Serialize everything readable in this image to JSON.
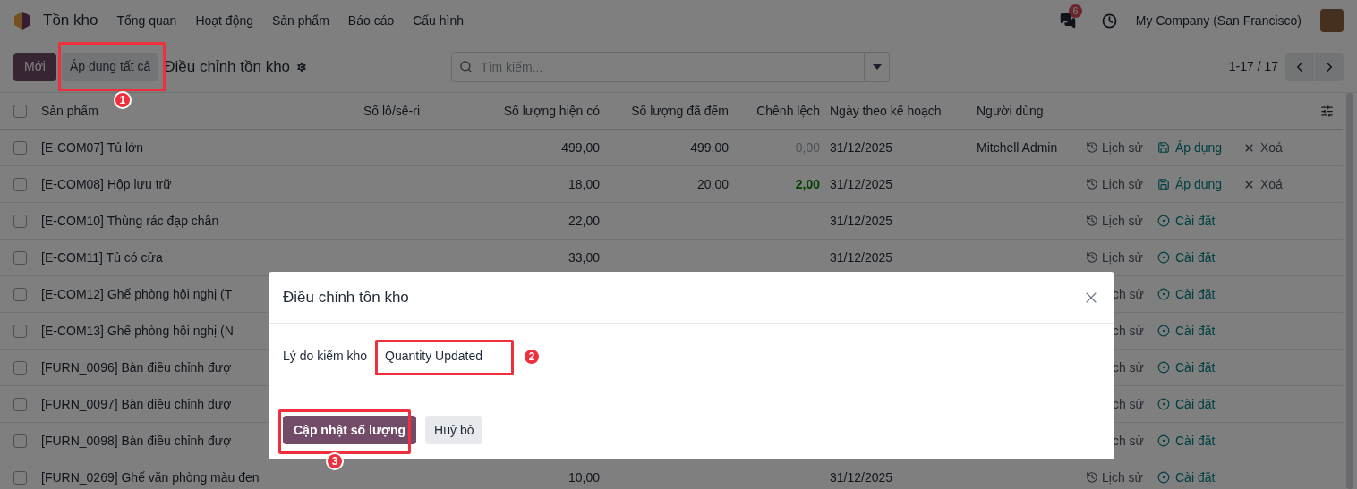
{
  "navbar": {
    "app_name": "Tồn kho",
    "menu": [
      "Tổng quan",
      "Hoạt động",
      "Sản phẩm",
      "Báo cáo",
      "Cấu hình"
    ],
    "message_count": "6",
    "company": "My Company (San Francisco)"
  },
  "control_panel": {
    "new_button": "Mới",
    "apply_all_button": {
      "label": "Áp dụng tất cả",
      "annotation": "1"
    },
    "title": "Điều chỉnh tồn kho",
    "search": {
      "placeholder": "Tìm kiếm..."
    },
    "pager": "1-17 / 17"
  },
  "table": {
    "select_all": {
      "checked": false
    },
    "columns": [
      "Sản phẩm",
      "Số lô/sê-ri",
      "Số lượng hiện có",
      "Số lượng đã đếm",
      "Chênh lệch",
      "Ngày theo kế hoạch",
      "Người dùng"
    ],
    "rows": [
      {
        "checked": false,
        "product": "[E-COM07] Tủ lớn",
        "on_hand": "499,00",
        "counted": "499,00",
        "difference": {
          "text": "0,00",
          "emphasized": false
        },
        "date": "31/12/2025",
        "user": "Mitchell Admin",
        "actions": [
          {
            "kind": "history",
            "label": "Lịch sử"
          },
          {
            "kind": "apply",
            "label": "Áp dụng"
          },
          {
            "kind": "delete",
            "label": "Xoá"
          }
        ]
      },
      {
        "checked": false,
        "product": "[E-COM08] Hộp lưu trữ",
        "on_hand": "18,00",
        "counted": "20,00",
        "difference": {
          "text": "2,00",
          "emphasized": true
        },
        "date": "31/12/2025",
        "actions": [
          {
            "kind": "history",
            "label": "Lịch sử"
          },
          {
            "kind": "apply",
            "label": "Áp dụng"
          },
          {
            "kind": "delete",
            "label": "Xoá"
          }
        ]
      },
      {
        "checked": false,
        "product": "[E-COM10] Thùng rác đạp chân",
        "on_hand": "22,00",
        "date": "31/12/2025",
        "actions": [
          {
            "kind": "history",
            "label": "Lịch sử"
          },
          {
            "kind": "install",
            "label": "Cài đặt"
          }
        ]
      },
      {
        "checked": false,
        "product": "[E-COM11] Tủ có cửa",
        "on_hand": "33,00",
        "date": "31/12/2025",
        "actions": [
          {
            "kind": "history",
            "label": "Lịch sử"
          },
          {
            "kind": "install",
            "label": "Cài đặt"
          }
        ]
      },
      {
        "checked": false,
        "product": "[E-COM12] Ghế phòng hội nghị (T",
        "actions": [
          {
            "kind": "history_cut",
            "label": "ch sử"
          },
          {
            "kind": "install",
            "label": "Cài đặt"
          }
        ]
      },
      {
        "checked": false,
        "product": "[E-COM13] Ghế phòng hội nghị (N",
        "actions": [
          {
            "kind": "history_cut",
            "label": "ch sử"
          },
          {
            "kind": "install",
            "label": "Cài đặt"
          }
        ]
      },
      {
        "checked": false,
        "product": "[FURN_0096] Bàn điều chỉnh đượ",
        "actions": [
          {
            "kind": "history_cut",
            "label": "ch sử"
          },
          {
            "kind": "install",
            "label": "Cài đặt"
          }
        ]
      },
      {
        "checked": false,
        "product": "[FURN_0097] Bàn điều chỉnh đượ",
        "actions": [
          {
            "kind": "history_cut",
            "label": "ch sử"
          },
          {
            "kind": "install",
            "label": "Cài đặt"
          }
        ]
      },
      {
        "checked": false,
        "product": "[FURN_0098] Bàn điều chỉnh đượ",
        "actions": [
          {
            "kind": "history_cut",
            "label": "ch sử"
          },
          {
            "kind": "install",
            "label": "Cài đặt"
          }
        ]
      },
      {
        "checked": false,
        "product": "[FURN_0269] Ghế văn phòng màu đen",
        "on_hand": "10,00",
        "date": "31/12/2025",
        "actions": [
          {
            "kind": "history",
            "label": "Lịch sử"
          },
          {
            "kind": "install",
            "label": "Cài đặt"
          }
        ]
      }
    ]
  },
  "dialog": {
    "title": "Điều chỉnh tồn kho",
    "field": {
      "label": "Lý do kiểm kho",
      "value": "Quantity Updated",
      "annotation": "2"
    },
    "confirm_button": {
      "label": "Cập nhật số lượng",
      "annotation": "3"
    },
    "cancel_button": "Huỷ bỏ"
  }
}
